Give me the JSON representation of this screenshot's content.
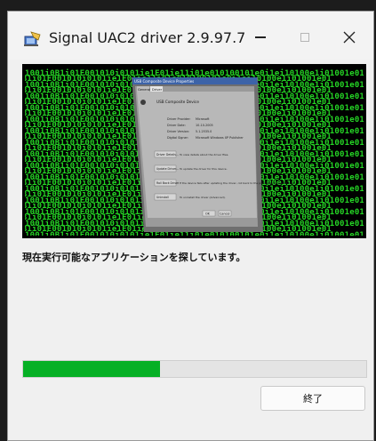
{
  "window": {
    "title": "Signal UAC2 driver 2.9.97.7"
  },
  "banner": {
    "dialog_title": "USB Composite Device Properties",
    "tabs": [
      "General",
      "Driver"
    ],
    "device_name": "USB Composite Device",
    "fields": [
      {
        "label": "Driver Provider:",
        "value": "Microsoft"
      },
      {
        "label": "Driver Date:",
        "value": "10-10-2005"
      },
      {
        "label": "Driver Version:",
        "value": "5.1.2535.0"
      },
      {
        "label": "Digital Signer:",
        "value": "Microsoft Windows XP Publisher"
      }
    ],
    "buttons": [
      {
        "label": "Driver Details...",
        "desc": "To view details about the driver files."
      },
      {
        "label": "Update Driver...",
        "desc": "To update the driver for this device."
      },
      {
        "label": "Roll Back Driver",
        "desc": "If the device fails after updating the driver, roll back to the previously installed driver."
      },
      {
        "label": "Uninstall",
        "desc": "To uninstall the driver (Advanced)."
      }
    ],
    "ok_label": "OK",
    "cancel_label": "Cancel",
    "accent_green": "#26d926"
  },
  "status": {
    "message": "現在実行可能なアプリケーションを探しています。"
  },
  "progress": {
    "percent": 40,
    "color": "#06b025"
  },
  "actions": {
    "exit_label": "終了"
  }
}
